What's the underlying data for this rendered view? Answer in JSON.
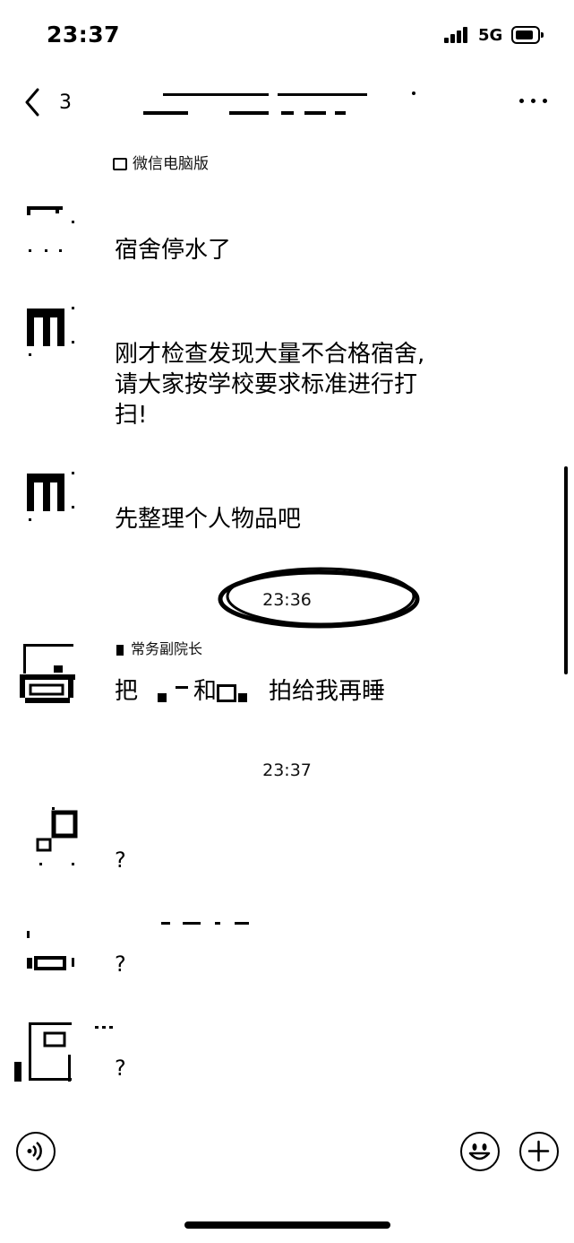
{
  "status_bar": {
    "time": "23:37",
    "network": "5G"
  },
  "nav": {
    "back_count": "3",
    "more_icon": "more-horizontal-icon"
  },
  "source_tag": "微信电脑版",
  "messages": [
    {
      "text": "宿舍停水了"
    },
    {
      "lines": [
        "刚才检查发现大量不合格宿舍,",
        "请大家按学校要求标准进行打",
        "扫!"
      ]
    },
    {
      "text": "先整理个人物品吧"
    }
  ],
  "time_divider_1": "23:36",
  "message_4": {
    "sender": "常务副院长",
    "text": "把",
    "text_2": "和",
    "text_3": "拍给我再睡"
  },
  "time_divider_2": "23:37",
  "question_messages": [
    "?",
    "?",
    "?"
  ],
  "input_bar": {
    "voice_icon": "voice-icon",
    "emoji_icon": "emoji-icon",
    "plus_icon": "plus-icon"
  }
}
